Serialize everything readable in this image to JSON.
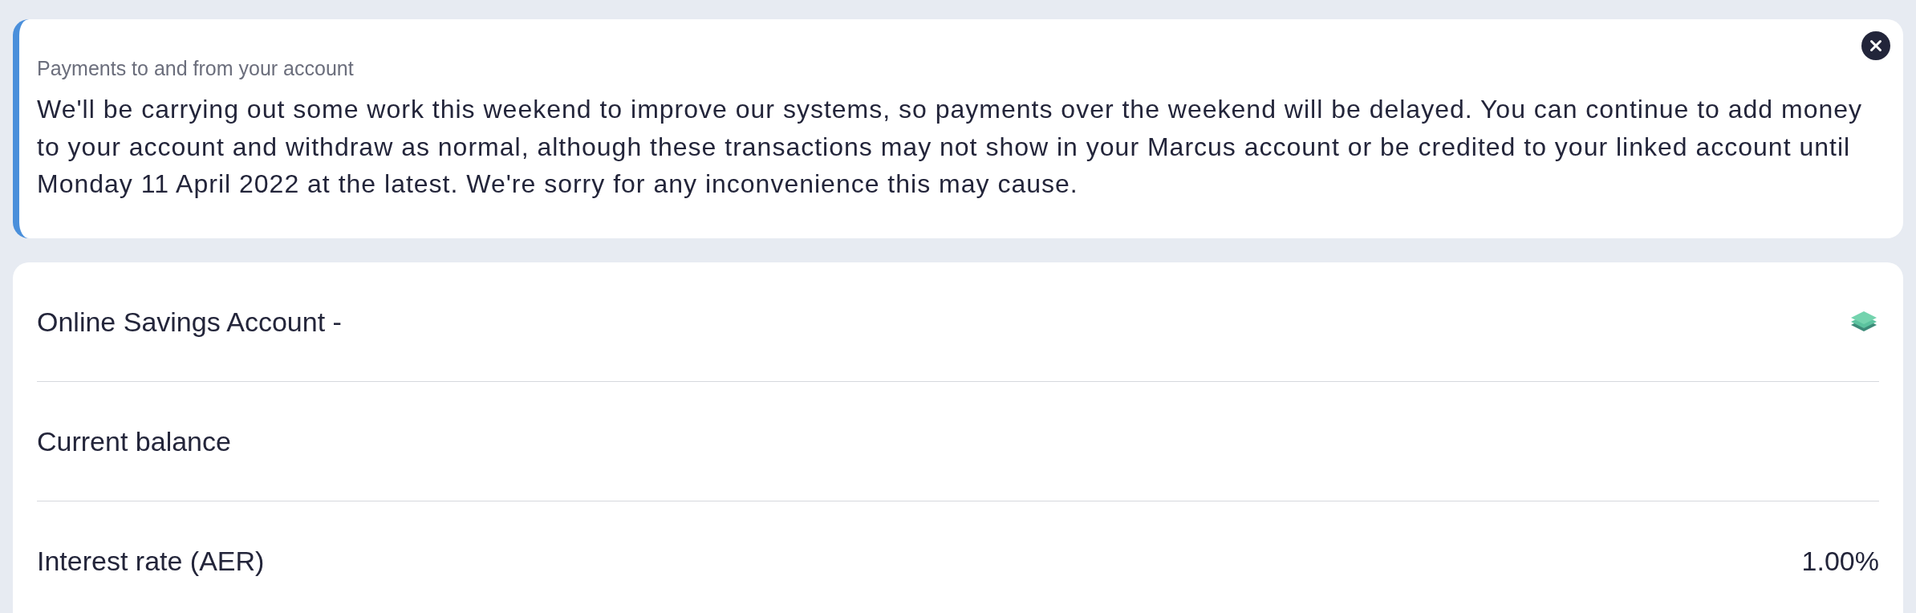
{
  "notice": {
    "title": "Payments to and from your account",
    "message": "We'll be carrying out some work this weekend to improve our systems, so payments over the weekend will be delayed. You can continue to add money to your account and withdraw as normal, although these transactions may not show in your Marcus account or be credited to your linked account until Monday 11 April 2022 at the latest. We're sorry for any inconvenience this may cause."
  },
  "account": {
    "name": "Online Savings Account -",
    "rows": [
      {
        "label": "Current balance"
      },
      {
        "label": "Interest rate (AER)",
        "value": "1.00%"
      }
    ]
  }
}
